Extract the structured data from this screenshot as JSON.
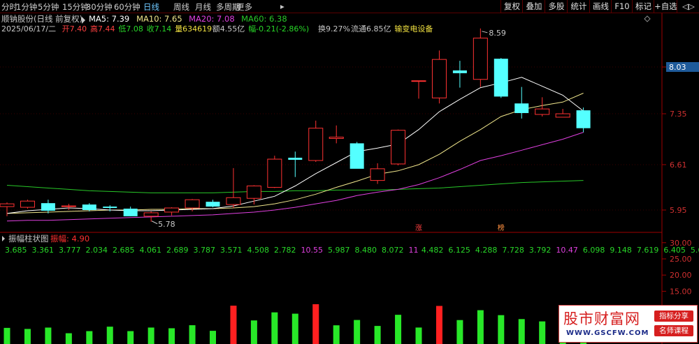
{
  "toolbar": {
    "periods": [
      "分时",
      "1分钟",
      "5分钟",
      "15分钟",
      "30分钟",
      "60分钟",
      "日线",
      "周线",
      "月线",
      "多周期",
      "更多"
    ],
    "active_index": 6,
    "more_arrow": "▸",
    "right_buttons": [
      "复权",
      "叠加",
      "多股",
      "统计",
      "画线",
      "F10",
      "标记",
      "+自选"
    ],
    "nav_arrows": "◁▷",
    "diamond_icon": "◇"
  },
  "stock": {
    "name_line": "顺钠股份(日线 前复权)",
    "ma_labels": [
      {
        "text": "MA5: 7.39",
        "color": "#ffffff"
      },
      {
        "text": "MA10: 7.65",
        "color": "#f0e68c"
      },
      {
        "text": "MA20: 7.08",
        "color": "#e040e0"
      },
      {
        "text": "MA60: 6.38",
        "color": "#28c828"
      }
    ],
    "info_segments": [
      {
        "text": "2025/06/17/二",
        "color": "#c8c8c8"
      },
      {
        "text": "开7.40",
        "color": "#ff4040"
      },
      {
        "text": "高7.44",
        "color": "#ff4040"
      },
      {
        "text": "低7.08",
        "color": "#28d828"
      },
      {
        "text": "收7.14",
        "color": "#28d828"
      },
      {
        "text": "量634619",
        "color": "#f0e040"
      },
      {
        "text": "额4.55亿",
        "color": "#c8c8c8"
      },
      {
        "text": "幅-0.21(-2.86%)",
        "color": "#28d828"
      },
      {
        "text": "换9.27%",
        "color": "#c8c8c8"
      },
      {
        "text": "流通6.85亿",
        "color": "#c8c8c8"
      },
      {
        "text": "输变电设备",
        "color": "#f0e040"
      }
    ]
  },
  "indicator": {
    "title": "振幅柱状图",
    "param_text": "振幅: 4.90",
    "values": [
      {
        "text": "3.685",
        "color": "#28d828"
      },
      {
        "text": "3.361",
        "color": "#28d828"
      },
      {
        "text": "3.777",
        "color": "#28d828"
      },
      {
        "text": "2.034",
        "color": "#28d828"
      },
      {
        "text": "2.685",
        "color": "#28d828"
      },
      {
        "text": "4.061",
        "color": "#28d828"
      },
      {
        "text": "2.689",
        "color": "#28d828"
      },
      {
        "text": "3.787",
        "color": "#28d828"
      },
      {
        "text": "3.571",
        "color": "#28d828"
      },
      {
        "text": "4.508",
        "color": "#28d828"
      },
      {
        "text": "2.782",
        "color": "#28d828"
      },
      {
        "text": "10.55",
        "color": "#e040e0"
      },
      {
        "text": "5.987",
        "color": "#28d828"
      },
      {
        "text": "8.480",
        "color": "#28d828"
      },
      {
        "text": "8.072",
        "color": "#28d828"
      },
      {
        "text": "11",
        "color": "#e040e0"
      },
      {
        "text": "4.482",
        "color": "#28d828"
      },
      {
        "text": "6.125",
        "color": "#28d828"
      },
      {
        "text": "4.288",
        "color": "#28d828"
      },
      {
        "text": "7.728",
        "color": "#28d828"
      },
      {
        "text": "3.792",
        "color": "#28d828"
      },
      {
        "text": "10.47",
        "color": "#e040e0"
      },
      {
        "text": "6.098",
        "color": "#28d828"
      },
      {
        "text": "9.148",
        "color": "#28d828"
      },
      {
        "text": "7.619",
        "color": "#28d828"
      },
      {
        "text": "6.405",
        "color": "#28d828"
      },
      {
        "text": "5.691",
        "color": "#28d828"
      },
      {
        "text": "2.834",
        "color": "#28d828"
      },
      {
        "text": "4.898",
        "color": "#28d828"
      }
    ]
  },
  "watermark": {
    "main": "股市财富网",
    "url": "WWW.GSCFW.COM",
    "tag1": "指标分享",
    "tag2": "名师课程"
  },
  "chart_data": {
    "type": "candlestick",
    "price_axis": {
      "ticks": [
        8.03,
        7.35,
        6.61,
        5.95
      ],
      "range": [
        5.56,
        8.85
      ],
      "highlight_tick": 8.03
    },
    "amplitude_axis": {
      "ticks": [
        30.0,
        25.0,
        20.0,
        15.0
      ],
      "range": [
        0,
        40
      ]
    },
    "annotations": {
      "high_label": "8.59",
      "low_label": "5.78"
    },
    "markers": [
      "涨",
      "榜"
    ],
    "candles": [
      {
        "o": 6.0,
        "h": 6.06,
        "l": 5.86,
        "c": 6.04
      },
      {
        "o": 5.99,
        "h": 6.1,
        "l": 5.97,
        "c": 6.08
      },
      {
        "o": 6.05,
        "h": 6.1,
        "l": 5.9,
        "c": 5.94
      },
      {
        "o": 6.0,
        "h": 6.04,
        "l": 5.95,
        "c": 6.01
      },
      {
        "o": 6.03,
        "h": 6.05,
        "l": 5.93,
        "c": 5.95
      },
      {
        "o": 6.0,
        "h": 6.02,
        "l": 5.93,
        "c": 5.98
      },
      {
        "o": 5.97,
        "h": 6.0,
        "l": 5.86,
        "c": 5.86
      },
      {
        "o": 5.86,
        "h": 5.93,
        "l": 5.78,
        "c": 5.91
      },
      {
        "o": 5.92,
        "h": 5.99,
        "l": 5.87,
        "c": 5.98
      },
      {
        "o": 5.98,
        "h": 6.11,
        "l": 5.93,
        "c": 6.1
      },
      {
        "o": 6.07,
        "h": 6.1,
        "l": 5.99,
        "c": 6.0
      },
      {
        "o": 6.03,
        "h": 6.56,
        "l": 5.98,
        "c": 6.13
      },
      {
        "o": 6.12,
        "h": 6.31,
        "l": 6.03,
        "c": 6.3
      },
      {
        "o": 6.28,
        "h": 6.74,
        "l": 6.27,
        "c": 6.69
      },
      {
        "o": 6.71,
        "h": 6.8,
        "l": 6.43,
        "c": 6.68
      },
      {
        "o": 6.67,
        "h": 7.25,
        "l": 6.65,
        "c": 7.14
      },
      {
        "o": 6.99,
        "h": 7.18,
        "l": 6.92,
        "c": 7.01
      },
      {
        "o": 6.92,
        "h": 6.94,
        "l": 6.57,
        "c": 6.55
      },
      {
        "o": 6.38,
        "h": 6.63,
        "l": 6.33,
        "c": 6.55
      },
      {
        "o": 6.62,
        "h": 7.12,
        "l": 6.6,
        "c": 7.11
      },
      {
        "o": 7.83,
        "h": 7.83,
        "l": 7.57,
        "c": 7.83
      },
      {
        "o": 7.58,
        "h": 8.27,
        "l": 7.5,
        "c": 8.14
      },
      {
        "o": 7.98,
        "h": 8.12,
        "l": 7.73,
        "c": 7.94
      },
      {
        "o": 7.85,
        "h": 8.59,
        "l": 7.74,
        "c": 8.45
      },
      {
        "o": 8.15,
        "h": 8.16,
        "l": 7.58,
        "c": 7.6
      },
      {
        "o": 7.5,
        "h": 7.74,
        "l": 7.28,
        "c": 7.36
      },
      {
        "o": 7.34,
        "h": 7.59,
        "l": 7.31,
        "c": 7.42
      },
      {
        "o": 7.3,
        "h": 7.42,
        "l": 7.3,
        "c": 7.35
      },
      {
        "o": 7.4,
        "h": 7.44,
        "l": 7.08,
        "c": 7.14
      }
    ],
    "ma5": [
      5.86,
      5.9,
      5.94,
      5.96,
      5.98,
      5.97,
      5.95,
      5.94,
      5.94,
      5.95,
      5.96,
      5.97,
      6.01,
      6.08,
      6.15,
      6.3,
      6.48,
      6.64,
      6.8,
      6.85,
      6.91,
      7.12,
      7.38,
      7.56,
      7.73,
      7.8,
      7.88,
      7.75,
      7.62,
      7.39
    ],
    "ma10": [
      5.88,
      5.9,
      5.91,
      5.92,
      5.93,
      5.94,
      5.95,
      5.95,
      5.96,
      5.96,
      5.97,
      5.97,
      5.98,
      6.0,
      6.04,
      6.1,
      6.18,
      6.28,
      6.37,
      6.47,
      6.52,
      6.61,
      6.76,
      6.95,
      7.12,
      7.31,
      7.41,
      7.47,
      7.52,
      7.65
    ],
    "ma20": [
      5.78,
      5.79,
      5.8,
      5.8,
      5.81,
      5.82,
      5.83,
      5.84,
      5.85,
      5.86,
      5.87,
      5.88,
      5.9,
      5.92,
      5.95,
      5.99,
      6.04,
      6.09,
      6.16,
      6.21,
      6.25,
      6.32,
      6.42,
      6.54,
      6.67,
      6.74,
      6.82,
      6.9,
      6.98,
      7.08
    ],
    "ma60": [
      6.31,
      6.29,
      6.27,
      6.25,
      6.23,
      6.22,
      6.21,
      6.2,
      6.2,
      6.2,
      6.2,
      6.21,
      6.22,
      6.22,
      6.23,
      6.23,
      6.24,
      6.24,
      6.24,
      6.25,
      6.26,
      6.27,
      6.29,
      6.31,
      6.33,
      6.35,
      6.36,
      6.37,
      6.38
    ],
    "amplitude_bars": [
      3.685,
      3.361,
      3.777,
      2.034,
      2.685,
      4.061,
      2.689,
      3.787,
      3.571,
      4.508,
      2.782,
      10.55,
      5.987,
      8.48,
      8.072,
      11,
      4.482,
      6.125,
      4.288,
      7.728,
      3.792,
      10.47,
      6.098,
      9.148,
      7.619,
      6.405,
      5.691,
      2.834,
      4.898
    ],
    "colors": {
      "up": "#ff3232",
      "down": "#54ffff",
      "ma5": "#ffffff",
      "ma10": "#f0e68c",
      "ma20": "#e040e0",
      "ma60": "#28c828",
      "bar_normal": "#28e828",
      "bar_high": "#ff2020",
      "axis": "#a00000"
    }
  }
}
